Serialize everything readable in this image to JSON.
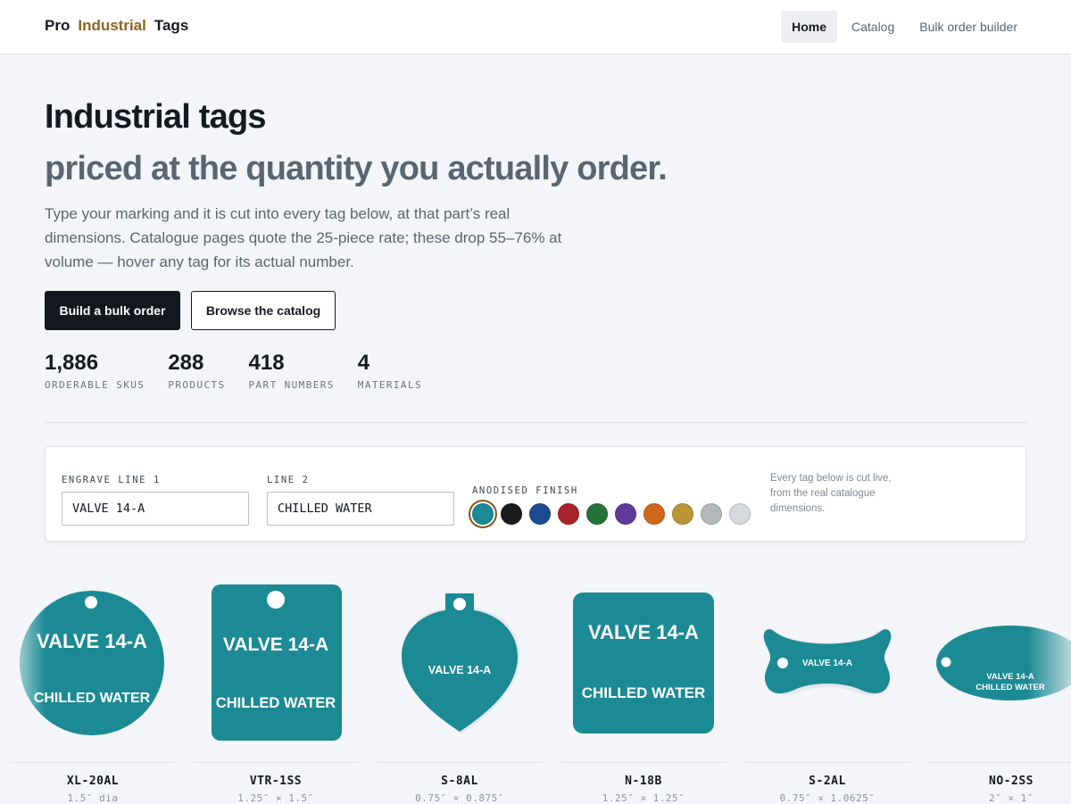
{
  "brand": {
    "part1": "Pro",
    "part2": "Industrial",
    "part3": "Tags",
    "accent_color": "#8b6421"
  },
  "nav": {
    "home": "Home",
    "catalog": "Catalog",
    "bulk": "Bulk order builder"
  },
  "hero": {
    "title": "Industrial tags",
    "subtitle": "priced at the quantity you actually order.",
    "lead": "Type your marking and it is cut into every tag below, at that part’s real dimensions. Catalogue pages quote the 25-piece rate; these drop 55–76% at volume — hover any tag for its actual number.",
    "primary_button": "Build a bulk order",
    "secondary_button": "Browse the catalog"
  },
  "stats": [
    {
      "value": "1,886",
      "label": "ORDERABLE SKUS"
    },
    {
      "value": "288",
      "label": "PRODUCTS"
    },
    {
      "value": "418",
      "label": "PART NUMBERS"
    },
    {
      "value": "4",
      "label": "MATERIALS"
    }
  ],
  "controls": {
    "line1_label": "ENGRAVE LINE 1",
    "line1_value": "VALVE 14-A",
    "line2_label": "LINE 2",
    "line2_value": "CHILLED WATER",
    "finish_label": "ANODISED FINISH",
    "selected_finish": "teal",
    "finishes": [
      {
        "name": "teal",
        "color": "#1b8a94"
      },
      {
        "name": "black",
        "color": "#1a1b1d"
      },
      {
        "name": "blue",
        "color": "#1c4a92"
      },
      {
        "name": "red",
        "color": "#a8232a"
      },
      {
        "name": "green",
        "color": "#237238"
      },
      {
        "name": "purple",
        "color": "#5f3a98"
      },
      {
        "name": "orange",
        "color": "#d0661c"
      },
      {
        "name": "gold",
        "color": "#b99533"
      },
      {
        "name": "silver",
        "color": "#b4b9be"
      },
      {
        "name": "light-silver",
        "color": "#d6dadf"
      }
    ],
    "note": "Every tag below is cut live, from the real catalogue dimensions."
  },
  "tags": [
    {
      "part": "XL-20AL",
      "dims": "1.5″ dia"
    },
    {
      "part": "VTR-1SS",
      "dims": "1.25″ × 1.5″"
    },
    {
      "part": "S-8AL",
      "dims": "0.75″ × 0.875″"
    },
    {
      "part": "N-18B",
      "dims": "1.25″ × 1.25″"
    },
    {
      "part": "S-2AL",
      "dims": "0.75″ × 1.0625″"
    },
    {
      "part": "NO-2SS",
      "dims": "2″ × 1″"
    }
  ],
  "tag_color": "#1b8a94"
}
